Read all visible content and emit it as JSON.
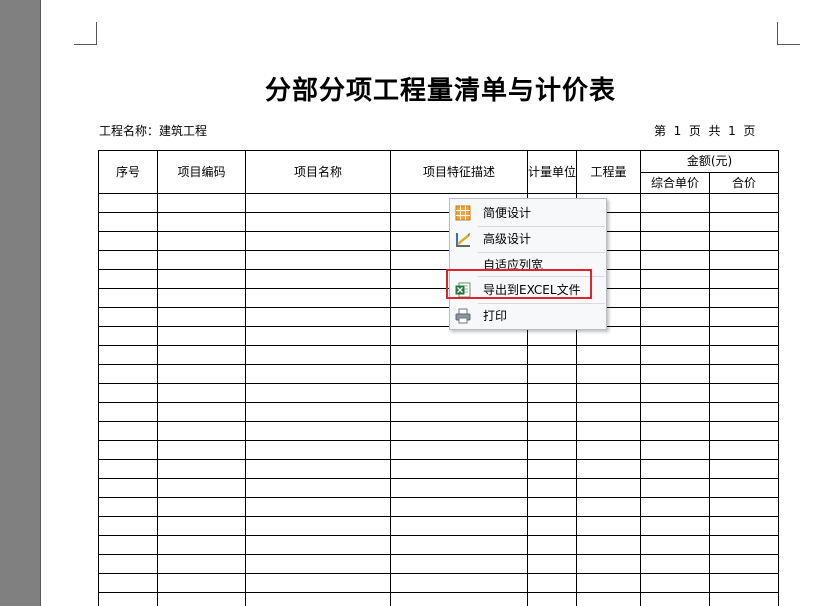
{
  "document": {
    "title": "分部分项工程量清单与计价表",
    "project_label": "工程名称：建筑工程",
    "page_info": "第  1  页  共  1  页"
  },
  "table": {
    "headers": {
      "seq": "序号",
      "code": "项目编码",
      "name": "项目名称",
      "feature": "项目特征描述",
      "unit": "计量单位",
      "quantity": "工程量",
      "amount": "金额(元)",
      "unit_price": "综合单价",
      "total": "合价"
    }
  },
  "context_menu": {
    "items": [
      {
        "label": "简便设计",
        "icon": "grid-design-icon"
      },
      {
        "label": "高级设计",
        "icon": "advanced-design-icon"
      },
      {
        "label": "自适应列宽",
        "icon": ""
      },
      {
        "label": "导出到EXCEL文件",
        "icon": "excel-icon"
      },
      {
        "label": "打印",
        "icon": "printer-icon"
      }
    ],
    "highlighted_item": "导出到EXCEL文件",
    "highlight_color": "#e0242b"
  }
}
